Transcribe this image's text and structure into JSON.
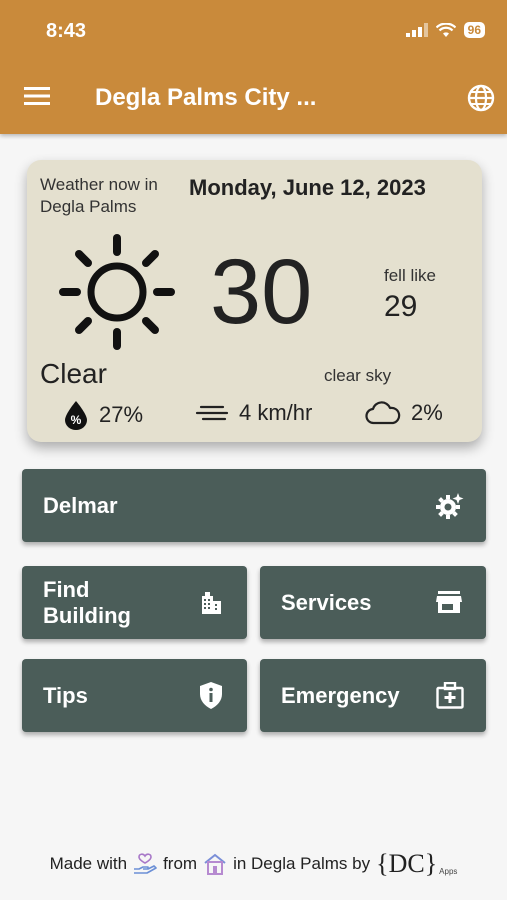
{
  "status": {
    "time": "8:43",
    "battery": "96"
  },
  "appbar": {
    "title": "Degla Palms City ...",
    "menu_icon": "menu-icon",
    "globe_icon": "globe-icon"
  },
  "weather": {
    "label": "Weather now in Degla Palms",
    "date": "Monday, June 12, 2023",
    "temp": "30",
    "feel_label": "fell like",
    "feel_value": "29",
    "condition": "Clear",
    "description": "clear sky",
    "humidity": "27%",
    "wind": "4 km/hr",
    "clouds": "2%"
  },
  "buttons": {
    "delmar": "Delmar",
    "find_building": "Find\nBuilding",
    "services": "Services",
    "tips": "Tips",
    "emergency": "Emergency"
  },
  "footer": {
    "made_with": "Made with",
    "from": "from",
    "in": "in Degla Palms by",
    "logo": "{DC}",
    "logo_sub": "Apps"
  },
  "colors": {
    "appbar": "#c98a3b",
    "card": "#e4e0cf",
    "button": "#4b5d59"
  }
}
